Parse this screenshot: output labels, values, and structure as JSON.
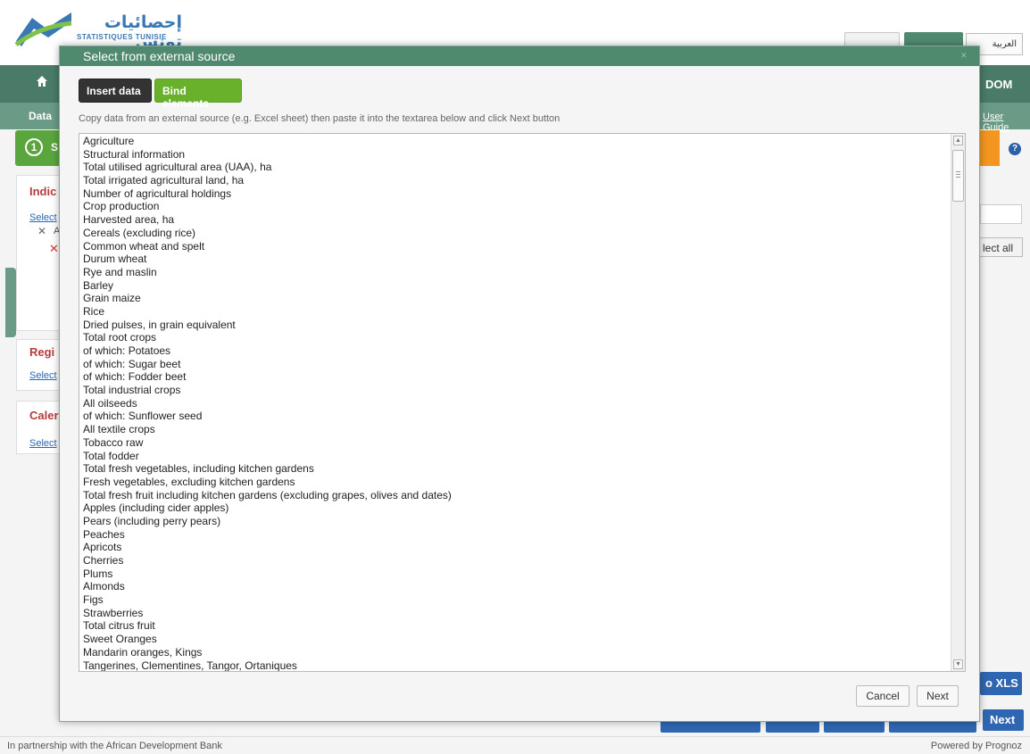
{
  "header": {
    "logo_arabic": "إحصائيات تونس",
    "logo_french": "STATISTIQUES TUNISIE",
    "lang_button": "العربية"
  },
  "navbar": {
    "dom_label": "DOM"
  },
  "subnav": {
    "data_label": "Data",
    "user_guide": "User Guide"
  },
  "step": {
    "number": "1",
    "label_initial": "S"
  },
  "panels": {
    "indicators_title": "Indic",
    "indicators_link": "Select",
    "indicators_item": "A",
    "regions_title": "Regi",
    "regions_link": "Select",
    "calendar_title": "Caler",
    "calendar_link": "Select"
  },
  "right": {
    "select_all": "lect all"
  },
  "bottom_buttons": {
    "xls": "o XLS",
    "next": "Next"
  },
  "footer": {
    "left": "In partnership with the African Development Bank",
    "right": "Powered by Prognoz"
  },
  "modal": {
    "title": "Select from external source",
    "tab_insert": "Insert data",
    "tab_bind": "Bind elements",
    "instructions": "Copy data from an external source (e.g. Excel sheet) then paste it into the textarea below and click Next button",
    "lines": [
      "Agriculture",
      "Structural information",
      "Total utilised agricultural area (UAA), ha",
      "Total irrigated agricultural land, ha",
      "Number of agricultural holdings",
      "Crop production",
      "Harvested area, ha",
      "Cereals (excluding rice)",
      "Common wheat and spelt",
      "Durum wheat",
      "Rye and maslin",
      "Barley",
      "Grain maize",
      "Rice",
      "Dried pulses, in grain equivalent",
      "Total root crops",
      "of which: Potatoes",
      "of which: Sugar beet",
      "of which: Fodder beet",
      "Total industrial crops",
      "All oilseeds",
      "of which: Sunflower seed",
      "All textile crops",
      "Tobacco raw",
      "Total fodder",
      "Total fresh vegetables, including kitchen gardens",
      "Fresh vegetables, excluding kitchen gardens",
      "Total fresh fruit including kitchen gardens (excluding grapes, olives and dates)",
      "Apples (including cider apples)",
      "Pears (including perry pears)",
      "Peaches",
      "Apricots",
      "Cherries",
      "Plums",
      "Almonds",
      "Figs",
      "Strawberries",
      "Total citrus fruit",
      "Sweet Oranges",
      "Mandarin oranges, Kings",
      "Tangerines, Clementines, Tangor, Ortaniques"
    ],
    "cancel": "Cancel",
    "next": "Next"
  }
}
